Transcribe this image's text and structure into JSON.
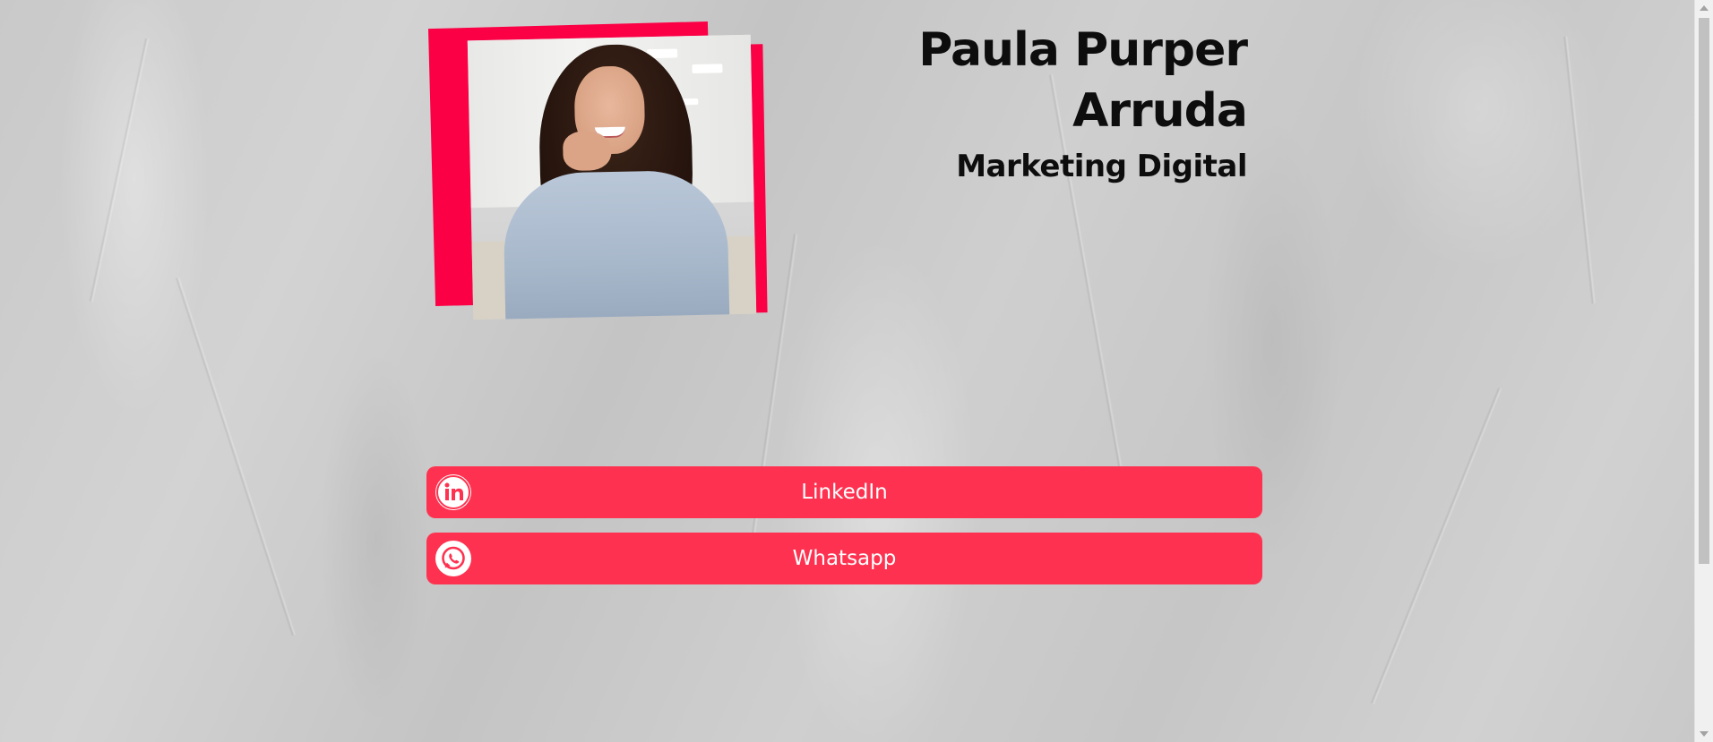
{
  "profile": {
    "name_line1": "Paula Purper",
    "name_line2": "Arruda",
    "role": "Marketing Digital",
    "photo_icon": "profile-photo"
  },
  "links": {
    "linkedin": {
      "label": "LinkedIn",
      "icon": "linkedin-icon"
    },
    "whatsapp": {
      "label": "Whatsapp",
      "icon": "whatsapp-icon"
    }
  },
  "colors": {
    "accent": "#fe3250",
    "photo_frame": "#fb0045",
    "text": "#0d0d0d",
    "background": "#cbcbcb"
  }
}
